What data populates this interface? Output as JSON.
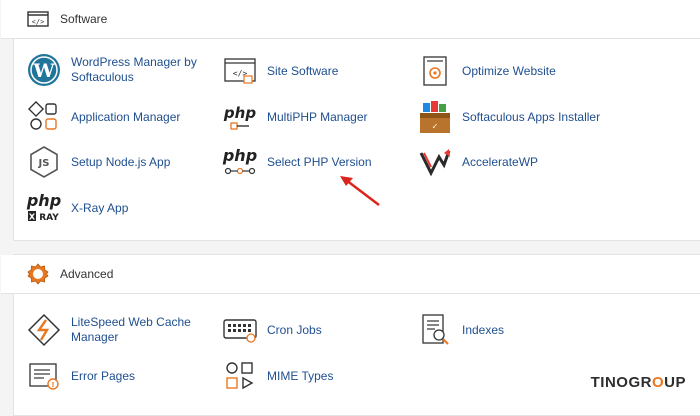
{
  "software": {
    "title": "Software",
    "items": [
      {
        "label": "WordPress Manager by Softaculous",
        "icon": "wordpress-icon"
      },
      {
        "label": "Site Software",
        "icon": "code-window-icon"
      },
      {
        "label": "Optimize Website",
        "icon": "gear-document-icon"
      },
      {
        "label": "Application Manager",
        "icon": "app-grid-icon"
      },
      {
        "label": "MultiPHP Manager",
        "icon": "php-icon"
      },
      {
        "label": "Softaculous Apps Installer",
        "icon": "softaculous-box-icon"
      },
      {
        "label": "Setup Node.js App",
        "icon": "nodejs-icon"
      },
      {
        "label": "Select PHP Version",
        "icon": "php-version-icon"
      },
      {
        "label": "AccelerateWP",
        "icon": "acceleratewp-icon"
      },
      {
        "label": "X-Ray App",
        "icon": "php-xray-icon"
      }
    ]
  },
  "advanced": {
    "title": "Advanced",
    "items": [
      {
        "label": "LiteSpeed Web Cache Manager",
        "icon": "litespeed-icon"
      },
      {
        "label": "Cron Jobs",
        "icon": "keyboard-icon"
      },
      {
        "label": "Indexes",
        "icon": "search-document-icon"
      },
      {
        "label": "Error Pages",
        "icon": "error-page-icon"
      },
      {
        "label": "MIME Types",
        "icon": "mime-types-icon"
      }
    ]
  },
  "brand": {
    "part1": "TINO",
    "part2": "GR",
    "part3": "O",
    "part4": "UP"
  },
  "colors": {
    "link": "#1f4f8f",
    "accent": "#e87722",
    "arrow": "#d9261c"
  }
}
